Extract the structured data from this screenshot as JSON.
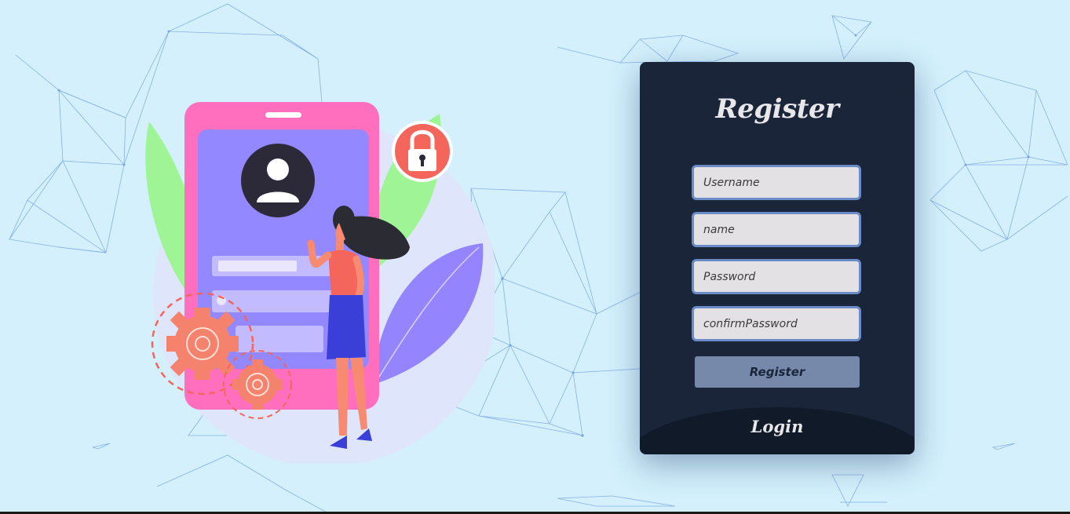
{
  "register": {
    "title": "Register",
    "username_placeholder": "Username",
    "name_placeholder": "name",
    "password_placeholder": "Password",
    "confirm_password_placeholder": "confirmPassword",
    "submit_label": "Register",
    "login_label": "Login"
  },
  "illustration": {
    "subject": "woman-with-phone-profile",
    "icons": [
      "user-avatar-icon",
      "lock-icon",
      "gear-icon"
    ]
  },
  "colors": {
    "background": "#d3f0fc",
    "panel": "#1b253a",
    "field_border": "#6a8bc5",
    "button": "#7689ab"
  }
}
